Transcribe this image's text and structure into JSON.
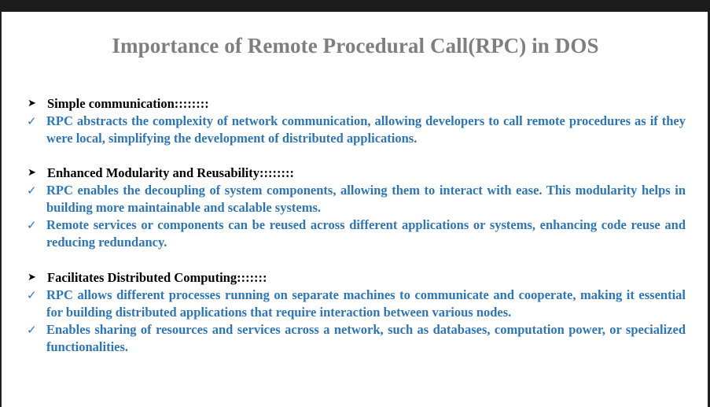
{
  "slide": {
    "title": "Importance of Remote Procedural Call(RPC) in DOS",
    "sections": [
      {
        "heading": "Simple communication::::::::",
        "points": [
          "RPC abstracts the complexity of network communication, allowing developers to call remote procedures as if they were local, simplifying the development of distributed applications."
        ]
      },
      {
        "heading": "Enhanced Modularity and Reusability::::::::",
        "points": [
          "RPC enables the decoupling of system components, allowing them to interact with ease. This modularity helps in building more maintainable and scalable systems.",
          "Remote services or components can be reused across different applications or systems, enhancing code reuse and reducing redundancy."
        ]
      },
      {
        "heading": "Facilitates Distributed Computing:::::::",
        "points": [
          "RPC allows different processes running on separate machines to communicate and cooperate, making it essential for building distributed applications that require interaction between various nodes.",
          "Enables sharing of resources and services across a network, such as databases, computation power, or specialized functionalities."
        ]
      }
    ]
  },
  "icons": {
    "heading_bullet": "arrowhead-bullet-icon",
    "point_bullet": "checkmark-icon"
  },
  "colors": {
    "title": "#7f7f7f",
    "heading": "#000000",
    "point": "#2e75b6",
    "background": "#ffffff",
    "frame": "#1c1c1c"
  }
}
